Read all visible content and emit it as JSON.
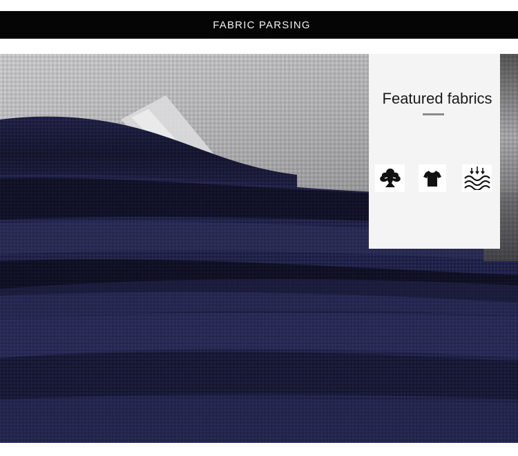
{
  "banner": {
    "title": "FABRIC PARSING"
  },
  "photo": {
    "subject": "close-up of knitted polo fabric",
    "colors": {
      "navy": "#1c1d3b",
      "light_grey": "#b9b9bb",
      "stripe_white": "#e8e8e8"
    }
  },
  "featured": {
    "title": "Featured fabrics",
    "icons": [
      {
        "name": "cotton-tree-icon"
      },
      {
        "name": "tshirt-icon"
      },
      {
        "name": "moisture-wicking-icon"
      }
    ]
  }
}
